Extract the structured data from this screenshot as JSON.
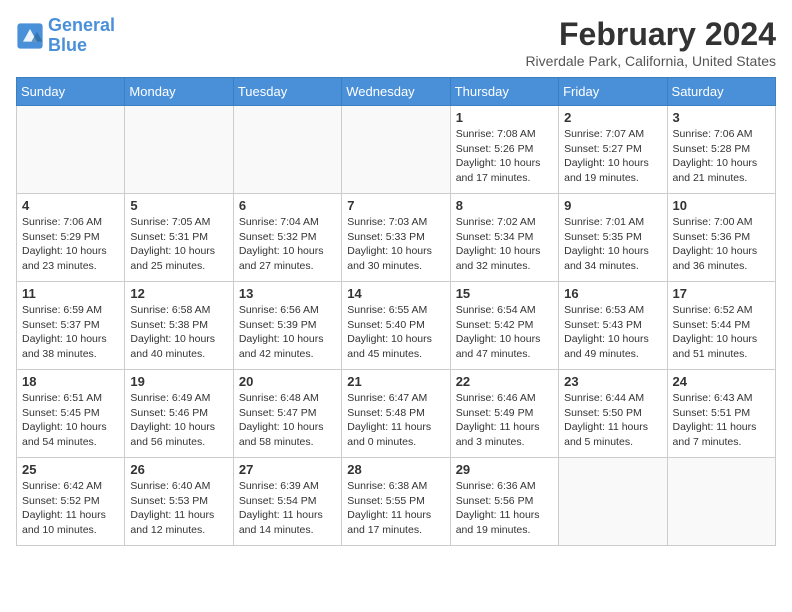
{
  "logo": {
    "line1": "General",
    "line2": "Blue"
  },
  "title": {
    "month_year": "February 2024",
    "location": "Riverdale Park, California, United States"
  },
  "days_of_week": [
    "Sunday",
    "Monday",
    "Tuesday",
    "Wednesday",
    "Thursday",
    "Friday",
    "Saturday"
  ],
  "weeks": [
    [
      {
        "day": "",
        "info": ""
      },
      {
        "day": "",
        "info": ""
      },
      {
        "day": "",
        "info": ""
      },
      {
        "day": "",
        "info": ""
      },
      {
        "day": "1",
        "info": "Sunrise: 7:08 AM\nSunset: 5:26 PM\nDaylight: 10 hours\nand 17 minutes."
      },
      {
        "day": "2",
        "info": "Sunrise: 7:07 AM\nSunset: 5:27 PM\nDaylight: 10 hours\nand 19 minutes."
      },
      {
        "day": "3",
        "info": "Sunrise: 7:06 AM\nSunset: 5:28 PM\nDaylight: 10 hours\nand 21 minutes."
      }
    ],
    [
      {
        "day": "4",
        "info": "Sunrise: 7:06 AM\nSunset: 5:29 PM\nDaylight: 10 hours\nand 23 minutes."
      },
      {
        "day": "5",
        "info": "Sunrise: 7:05 AM\nSunset: 5:31 PM\nDaylight: 10 hours\nand 25 minutes."
      },
      {
        "day": "6",
        "info": "Sunrise: 7:04 AM\nSunset: 5:32 PM\nDaylight: 10 hours\nand 27 minutes."
      },
      {
        "day": "7",
        "info": "Sunrise: 7:03 AM\nSunset: 5:33 PM\nDaylight: 10 hours\nand 30 minutes."
      },
      {
        "day": "8",
        "info": "Sunrise: 7:02 AM\nSunset: 5:34 PM\nDaylight: 10 hours\nand 32 minutes."
      },
      {
        "day": "9",
        "info": "Sunrise: 7:01 AM\nSunset: 5:35 PM\nDaylight: 10 hours\nand 34 minutes."
      },
      {
        "day": "10",
        "info": "Sunrise: 7:00 AM\nSunset: 5:36 PM\nDaylight: 10 hours\nand 36 minutes."
      }
    ],
    [
      {
        "day": "11",
        "info": "Sunrise: 6:59 AM\nSunset: 5:37 PM\nDaylight: 10 hours\nand 38 minutes."
      },
      {
        "day": "12",
        "info": "Sunrise: 6:58 AM\nSunset: 5:38 PM\nDaylight: 10 hours\nand 40 minutes."
      },
      {
        "day": "13",
        "info": "Sunrise: 6:56 AM\nSunset: 5:39 PM\nDaylight: 10 hours\nand 42 minutes."
      },
      {
        "day": "14",
        "info": "Sunrise: 6:55 AM\nSunset: 5:40 PM\nDaylight: 10 hours\nand 45 minutes."
      },
      {
        "day": "15",
        "info": "Sunrise: 6:54 AM\nSunset: 5:42 PM\nDaylight: 10 hours\nand 47 minutes."
      },
      {
        "day": "16",
        "info": "Sunrise: 6:53 AM\nSunset: 5:43 PM\nDaylight: 10 hours\nand 49 minutes."
      },
      {
        "day": "17",
        "info": "Sunrise: 6:52 AM\nSunset: 5:44 PM\nDaylight: 10 hours\nand 51 minutes."
      }
    ],
    [
      {
        "day": "18",
        "info": "Sunrise: 6:51 AM\nSunset: 5:45 PM\nDaylight: 10 hours\nand 54 minutes."
      },
      {
        "day": "19",
        "info": "Sunrise: 6:49 AM\nSunset: 5:46 PM\nDaylight: 10 hours\nand 56 minutes."
      },
      {
        "day": "20",
        "info": "Sunrise: 6:48 AM\nSunset: 5:47 PM\nDaylight: 10 hours\nand 58 minutes."
      },
      {
        "day": "21",
        "info": "Sunrise: 6:47 AM\nSunset: 5:48 PM\nDaylight: 11 hours\nand 0 minutes."
      },
      {
        "day": "22",
        "info": "Sunrise: 6:46 AM\nSunset: 5:49 PM\nDaylight: 11 hours\nand 3 minutes."
      },
      {
        "day": "23",
        "info": "Sunrise: 6:44 AM\nSunset: 5:50 PM\nDaylight: 11 hours\nand 5 minutes."
      },
      {
        "day": "24",
        "info": "Sunrise: 6:43 AM\nSunset: 5:51 PM\nDaylight: 11 hours\nand 7 minutes."
      }
    ],
    [
      {
        "day": "25",
        "info": "Sunrise: 6:42 AM\nSunset: 5:52 PM\nDaylight: 11 hours\nand 10 minutes."
      },
      {
        "day": "26",
        "info": "Sunrise: 6:40 AM\nSunset: 5:53 PM\nDaylight: 11 hours\nand 12 minutes."
      },
      {
        "day": "27",
        "info": "Sunrise: 6:39 AM\nSunset: 5:54 PM\nDaylight: 11 hours\nand 14 minutes."
      },
      {
        "day": "28",
        "info": "Sunrise: 6:38 AM\nSunset: 5:55 PM\nDaylight: 11 hours\nand 17 minutes."
      },
      {
        "day": "29",
        "info": "Sunrise: 6:36 AM\nSunset: 5:56 PM\nDaylight: 11 hours\nand 19 minutes."
      },
      {
        "day": "",
        "info": ""
      },
      {
        "day": "",
        "info": ""
      }
    ]
  ]
}
